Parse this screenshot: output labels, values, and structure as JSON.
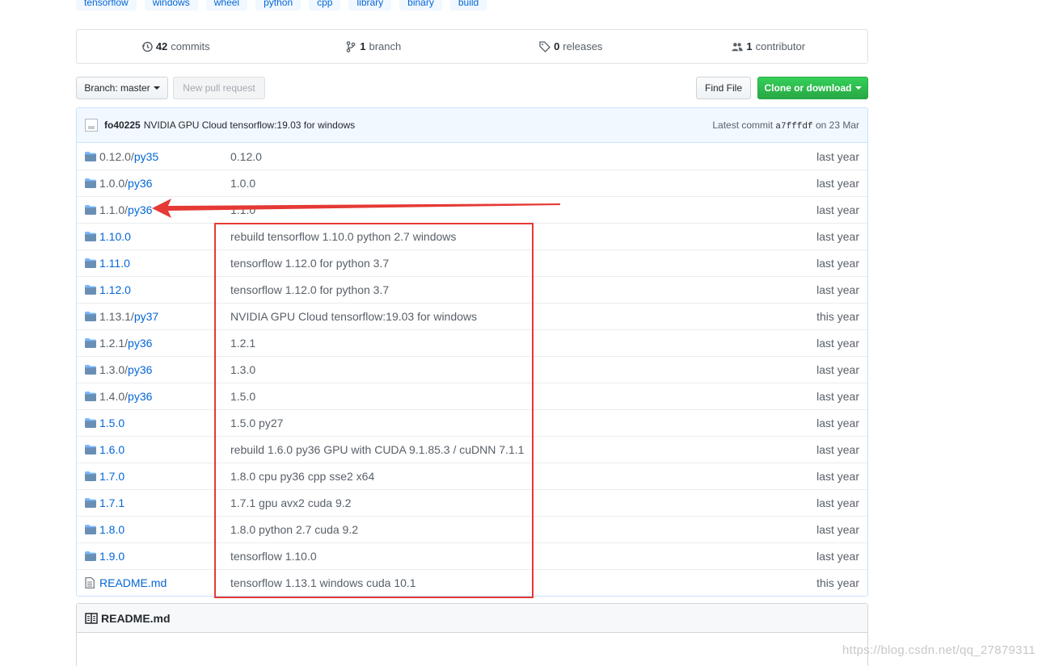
{
  "topics": [
    "tensorflow",
    "windows",
    "wheel",
    "python",
    "cpp",
    "library",
    "binary",
    "build"
  ],
  "stats": [
    {
      "icon": "history-icon",
      "count": "42",
      "label": "commits"
    },
    {
      "icon": "branch-icon",
      "count": "1",
      "label": "branch"
    },
    {
      "icon": "tag-icon",
      "count": "0",
      "label": "releases"
    },
    {
      "icon": "people-icon",
      "count": "1",
      "label": "contributor"
    }
  ],
  "toolbar": {
    "branch_label": "Branch: master",
    "new_pr_label": "New pull request",
    "find_file_label": "Find File",
    "clone_label": "Clone or download"
  },
  "commit": {
    "author": "fo40225",
    "message": "NVIDIA GPU Cloud tensorflow:19.03 for windows",
    "latest_label": "Latest commit",
    "sha": "a7fffdf",
    "date": "on 23 Mar"
  },
  "files": [
    {
      "type": "dir",
      "prefix": "0.12.0/",
      "name": "py35",
      "message": "0.12.0",
      "age": "last year"
    },
    {
      "type": "dir",
      "prefix": "1.0.0/",
      "name": "py36",
      "message": "1.0.0",
      "age": "last year"
    },
    {
      "type": "dir",
      "prefix": "1.1.0/",
      "name": "py36",
      "message": "1.1.0",
      "age": "last year"
    },
    {
      "type": "dir",
      "prefix": "",
      "name": "1.10.0",
      "message": "rebuild tensorflow 1.10.0 python 2.7 windows",
      "age": "last year"
    },
    {
      "type": "dir",
      "prefix": "",
      "name": "1.11.0",
      "message": "tensorflow 1.12.0 for python 3.7",
      "age": "last year"
    },
    {
      "type": "dir",
      "prefix": "",
      "name": "1.12.0",
      "message": "tensorflow 1.12.0 for python 3.7",
      "age": "last year"
    },
    {
      "type": "dir",
      "prefix": "1.13.1/",
      "name": "py37",
      "message": "NVIDIA GPU Cloud tensorflow:19.03 for windows",
      "age": "this year"
    },
    {
      "type": "dir",
      "prefix": "1.2.1/",
      "name": "py36",
      "message": "1.2.1",
      "age": "last year"
    },
    {
      "type": "dir",
      "prefix": "1.3.0/",
      "name": "py36",
      "message": "1.3.0",
      "age": "last year"
    },
    {
      "type": "dir",
      "prefix": "1.4.0/",
      "name": "py36",
      "message": "1.5.0",
      "age": "last year"
    },
    {
      "type": "dir",
      "prefix": "",
      "name": "1.5.0",
      "message": "1.5.0 py27",
      "age": "last year"
    },
    {
      "type": "dir",
      "prefix": "",
      "name": "1.6.0",
      "message": "rebuild 1.6.0 py36 GPU with CUDA 9.1.85.3 / cuDNN 7.1.1",
      "age": "last year"
    },
    {
      "type": "dir",
      "prefix": "",
      "name": "1.7.0",
      "message": "1.8.0 cpu py36 cpp sse2 x64",
      "age": "last year"
    },
    {
      "type": "dir",
      "prefix": "",
      "name": "1.7.1",
      "message": "1.7.1 gpu avx2 cuda 9.2",
      "age": "last year"
    },
    {
      "type": "dir",
      "prefix": "",
      "name": "1.8.0",
      "message": "1.8.0 python 2.7 cuda 9.2",
      "age": "last year"
    },
    {
      "type": "dir",
      "prefix": "",
      "name": "1.9.0",
      "message": "tensorflow 1.10.0",
      "age": "last year"
    },
    {
      "type": "file",
      "prefix": "",
      "name": "README.md",
      "message": "tensorflow 1.13.1 windows cuda 10.1",
      "age": "this year"
    }
  ],
  "readme": {
    "title": "README.md"
  },
  "annotations": {
    "arrow_color": "#e53935",
    "box_color": "#e53935"
  },
  "watermark": "https://blog.csdn.net/qq_27879311"
}
